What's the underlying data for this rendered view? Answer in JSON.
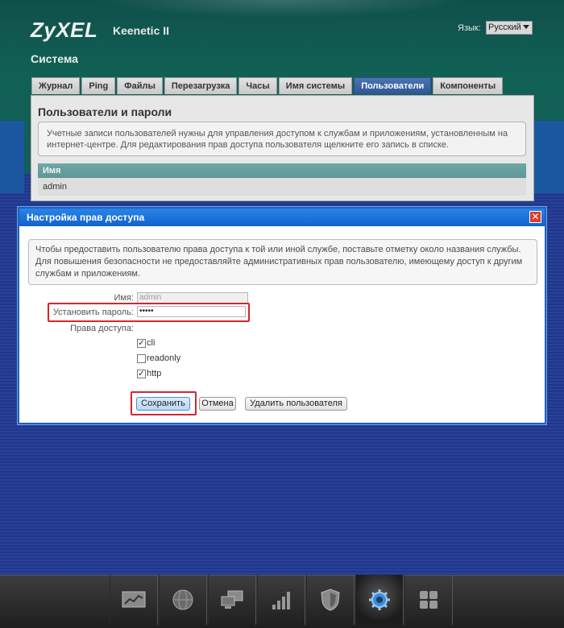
{
  "header": {
    "logo": "ZyXEL",
    "model": "Keenetic II",
    "language_label": "Язык:",
    "language_value": "Русский",
    "section_title": "Система"
  },
  "tabs": [
    {
      "label": "Журнал",
      "active": false
    },
    {
      "label": "Ping",
      "active": false
    },
    {
      "label": "Файлы",
      "active": false
    },
    {
      "label": "Перезагрузка",
      "active": false
    },
    {
      "label": "Часы",
      "active": false
    },
    {
      "label": "Имя системы",
      "active": false
    },
    {
      "label": "Пользователи",
      "active": true
    },
    {
      "label": "Компоненты",
      "active": false
    }
  ],
  "users_panel": {
    "title": "Пользователи и пароли",
    "info": "Учетные записи пользователей нужны для управления доступом к службам и приложениям, установленным на интернет-центре. Для редактирования прав доступа пользователя щелкните его запись в списке.",
    "column_header": "Имя",
    "rows": [
      "admin"
    ]
  },
  "dialog": {
    "title": "Настройка прав доступа",
    "close_symbol": "✕",
    "info": "Чтобы предоставить пользователю права доступа к той или иной службе, поставьте отметку около названия службы. Для повышения безопасности не предоставляйте административных прав пользователю, имеющему доступ к другим службам и приложениям.",
    "name_label": "Имя:",
    "name_value": "admin",
    "password_label": "Установить пароль:",
    "password_value": "•••••",
    "access_label": "Права доступа:",
    "permissions": [
      {
        "label": "cli",
        "checked": true
      },
      {
        "label": "readonly",
        "checked": false
      },
      {
        "label": "http",
        "checked": true
      }
    ],
    "save_label": "Сохранить",
    "cancel_label": "Отмена",
    "delete_label": "Удалить пользователя"
  },
  "bottom_bar": {
    "items": [
      {
        "icon": "monitor-chart-icon",
        "active": false
      },
      {
        "icon": "globe-icon",
        "active": false
      },
      {
        "icon": "network-computers-icon",
        "active": false
      },
      {
        "icon": "signal-bars-icon",
        "active": false
      },
      {
        "icon": "shield-icon",
        "active": false
      },
      {
        "icon": "gear-icon",
        "active": true
      },
      {
        "icon": "apps-grid-icon",
        "active": false
      }
    ]
  },
  "colors": {
    "accent": "#1063cf",
    "highlight": "#d4272c",
    "header_bg": "#116055"
  }
}
